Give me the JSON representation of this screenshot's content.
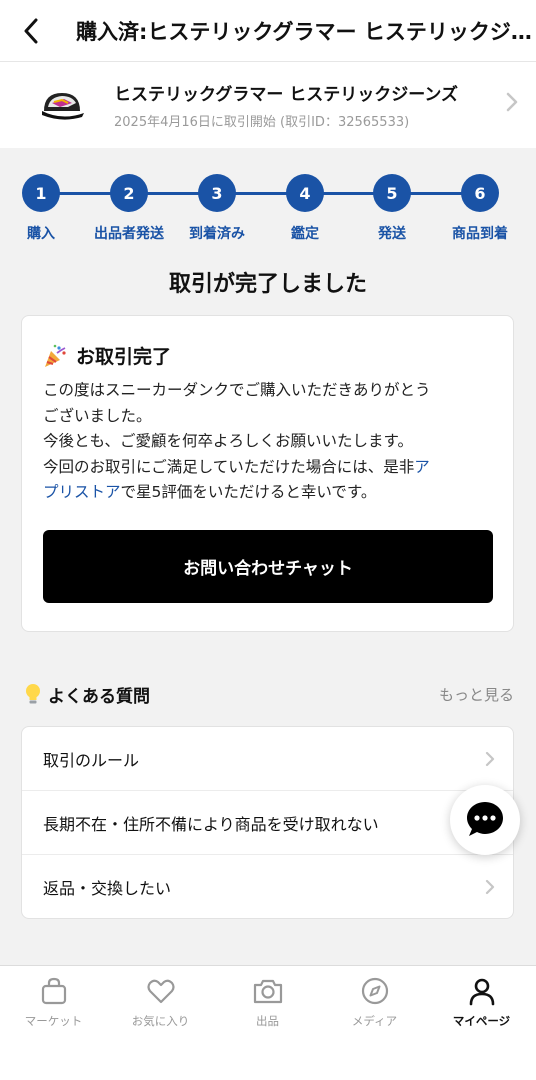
{
  "header": {
    "title": "購入済:ヒステリックグラマー ヒステリックジーンズ"
  },
  "product": {
    "name": "ヒステリックグラマー ヒステリックジーンズ",
    "meta": "2025年4月16日に取引開始 (取引ID：32565533)"
  },
  "stepper": {
    "steps": [
      {
        "number": "1",
        "label": "購入"
      },
      {
        "number": "2",
        "label": "出品者発送"
      },
      {
        "number": "3",
        "label": "到着済み"
      },
      {
        "number": "4",
        "label": "鑑定"
      },
      {
        "number": "5",
        "label": "発送"
      },
      {
        "number": "6",
        "label": "商品到着"
      }
    ],
    "color": "#1a53a6"
  },
  "status": {
    "heading": "取引が完了しました"
  },
  "card": {
    "icon": "party-popper-icon",
    "title": "お取引完了",
    "line1": "この度はスニーカーダンクでご購入いただきありがとう",
    "line2": "ございました。",
    "line3": "今後とも、ご愛顧を何卒よろしくお願いいたします。",
    "line4_pre": "今回のお取引にご満足していただけた場合には、是非",
    "line4_link": "ア",
    "line5_link": "プリストア",
    "line5_post": "で星5評価をいただけると幸いです。",
    "chat_button": "お問い合わせチャット"
  },
  "faq": {
    "icon": "lightbulb-icon",
    "title": "よくある質問",
    "more": "もっと見る",
    "items": [
      {
        "label": "取引のルール"
      },
      {
        "label": "長期不在・住所不備により商品を受け取れない"
      },
      {
        "label": "返品・交換したい"
      }
    ]
  },
  "tabbar": {
    "tabs": [
      {
        "label": "マーケット",
        "icon": "bag-icon"
      },
      {
        "label": "お気に入り",
        "icon": "heart-icon"
      },
      {
        "label": "出品",
        "icon": "camera-icon"
      },
      {
        "label": "メディア",
        "icon": "compass-icon"
      },
      {
        "label": "マイページ",
        "icon": "person-icon"
      }
    ],
    "active": "マイページ"
  }
}
